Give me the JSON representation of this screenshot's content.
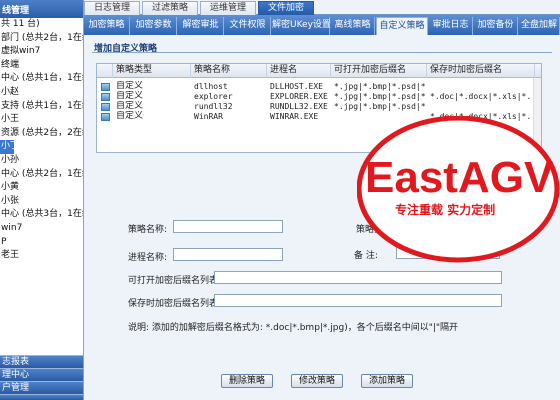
{
  "left_panel": {
    "header": "线管理",
    "tree": [
      "共 11 台)",
      "部门 (总共2台，1在线)",
      "虚拟win7",
      "终端",
      "中心 (总共1台，1在线)",
      "小赵",
      "支持 (总共1台，1在线)",
      "小王",
      "资源 (总共2台，2在线)",
      "小丁",
      "小孙",
      "中心 (总共2台，1在线)",
      "小黄",
      "小张",
      "中心 (总共3台，1在线)",
      "win7",
      "P",
      "老王"
    ],
    "selected_index": 9,
    "bottom_nav": [
      "志报表",
      "理中心",
      "户管理"
    ]
  },
  "top_tabs": [
    "日志管理",
    "过滤策略",
    "运维管理",
    "文件加密"
  ],
  "top_tab_active": 3,
  "module_tabs": [
    "加密策略",
    "加密参数",
    "解密审批",
    "文件权限",
    "解密UKey设置",
    "离线策略",
    "自定义策略",
    "审批日志",
    "加密备份",
    "全盘加解"
  ],
  "module_tab_active": 6,
  "panel": {
    "title": "增加自定义策略",
    "columns": [
      "策略类型",
      "策略名称",
      "进程名",
      "可打开加密后缀名",
      "保存时加密后缀名"
    ],
    "rows": [
      [
        "自定义",
        "dllhost",
        "DLLHOST.EXE",
        "*.jpg|*.bmp|*.psd|*...",
        ""
      ],
      [
        "自定义",
        "explorer",
        "EXPLORER.EXE",
        "*.jpg|*.bmp|*.psd|*...",
        "*.doc|*.docx|*.xls|*..."
      ],
      [
        "自定义",
        "rundll32",
        "RUNDLL32.EXE",
        "*.jpg|*.bmp|*.psd|*.gif",
        ""
      ],
      [
        "自定义",
        "WinRAR",
        "WINRAR.EXE",
        "",
        "*.doc|*.docx|*.xls|*..."
      ]
    ]
  },
  "form": {
    "policy_name_label": "策略名称:",
    "policy_name_value": "",
    "policy_category_label": "策略分类:",
    "policy_category_value": "",
    "process_name_label": "进程名称:",
    "process_name_value": "",
    "remark_label": "备 注:",
    "remark_value": "",
    "open_ext_label": "可打开加密后缀名列表:",
    "open_ext_value": "",
    "save_ext_label": "保存时加密后缀名列表:",
    "save_ext_value": "",
    "note": "说明: 添加的加解密后缀名格式为: *.doc|*.bmp|*.jpg)，各个后缀名中间以\"|\"隔开"
  },
  "buttons": {
    "delete": "删除策略",
    "modify": "修改策略",
    "add": "添加策略"
  },
  "watermark": {
    "brand": "EastAGV",
    "slogan": "专注重载  实力定制",
    "color": "#e0191f"
  }
}
